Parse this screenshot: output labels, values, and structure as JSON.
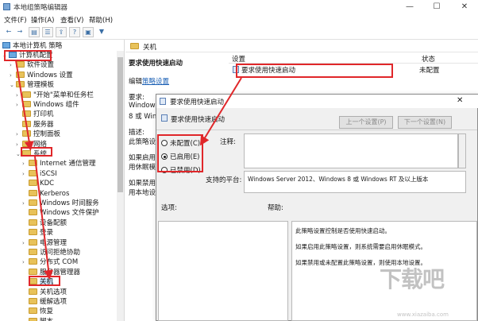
{
  "window": {
    "title": "本地组策略编辑器",
    "minimize": "—",
    "maximize": "☐",
    "close": "✕"
  },
  "menu": [
    "文件(F)",
    "操作(A)",
    "查看(V)",
    "帮助(H)"
  ],
  "toolbar_icons": [
    "back-icon",
    "forward-icon",
    "show-hide-tree-icon",
    "list-icon",
    "export-icon",
    "help-icon",
    "properties-icon",
    "filter-icon"
  ],
  "tree": {
    "root": "本地计算机 策略",
    "items": [
      {
        "label": "计算机配置",
        "arrow": "⌄"
      },
      {
        "label": "软件设置",
        "arrow": "›"
      },
      {
        "label": "Windows 设置",
        "arrow": "›"
      },
      {
        "label": "管理模板",
        "arrow": "⌄"
      },
      {
        "label": "\"开始\"菜单和任务栏",
        "arrow": "›"
      },
      {
        "label": "Windows 组件",
        "arrow": "›"
      },
      {
        "label": "打印机",
        "arrow": ""
      },
      {
        "label": "服务器",
        "arrow": ""
      },
      {
        "label": "控制面板",
        "arrow": "›"
      },
      {
        "label": "网络",
        "arrow": "›"
      },
      {
        "label": "系统",
        "arrow": "⌄"
      },
      {
        "label": "Internet 通信管理",
        "arrow": "›"
      },
      {
        "label": "iSCSI",
        "arrow": "›"
      },
      {
        "label": "KDC",
        "arrow": ""
      },
      {
        "label": "Kerberos",
        "arrow": ""
      },
      {
        "label": "Windows 时间服务",
        "arrow": "›"
      },
      {
        "label": "Windows 文件保护",
        "arrow": ""
      },
      {
        "label": "设备配额",
        "arrow": ""
      },
      {
        "label": "登录",
        "arrow": ""
      },
      {
        "label": "电源管理",
        "arrow": "›"
      },
      {
        "label": "访问拒绝协助",
        "arrow": ""
      },
      {
        "label": "分布式 COM",
        "arrow": "›"
      },
      {
        "label": "服务器管理器",
        "arrow": ""
      },
      {
        "label": "关机",
        "arrow": ""
      },
      {
        "label": "关机选项",
        "arrow": ""
      },
      {
        "label": "缓解选项",
        "arrow": ""
      },
      {
        "label": "恢复",
        "arrow": ""
      },
      {
        "label": "脚本",
        "arrow": ""
      }
    ]
  },
  "right": {
    "folder": "关机",
    "policy_title": "要求使用快速启动",
    "edit_prefix": "编辑",
    "edit_link": "策略设置",
    "req_label": "要求:",
    "req_lines": [
      "Windows",
      "8 或 Wind"
    ],
    "desc_label": "描述:",
    "desc_lines": [
      "此策略设",
      "",
      "如果启用此",
      "用休眠模式",
      "",
      "如果禁用或",
      "用本地设置"
    ],
    "col_setting": "设置",
    "col_state": "状态",
    "row_name": "要求使用快速启动",
    "row_state": "未配置"
  },
  "dialog": {
    "title": "要求使用快速启动",
    "close": "✕",
    "heading": "要求使用快速启动",
    "prev_btn": "上一个设置(P)",
    "next_btn": "下一个设置(N)",
    "radios": [
      {
        "label": "未配置(C)",
        "checked": false
      },
      {
        "label": "已启用(E)",
        "checked": true
      },
      {
        "label": "已禁用(D)",
        "checked": false
      }
    ],
    "comment_label": "注释:",
    "platform_label": "支持的平台:",
    "platform_value": "Windows Server 2012、Windows 8 或 Windows RT 及以上版本",
    "options_label": "选项:",
    "help_label": "帮助:",
    "help_lines": [
      "此策略设置控制是否使用快速启动。",
      "如果启用此策略设置，则系统需要启用休眠模式。",
      "如果禁用或未配置此策略设置，则使用本地设置。"
    ]
  },
  "watermark": {
    "big": "下载吧",
    "small": "www.xiazaiba.com"
  },
  "colors": {
    "highlight": "#e0272a",
    "selection": "#cce4f7",
    "link": "#1a5fb4",
    "folder": "#e8c25a"
  }
}
